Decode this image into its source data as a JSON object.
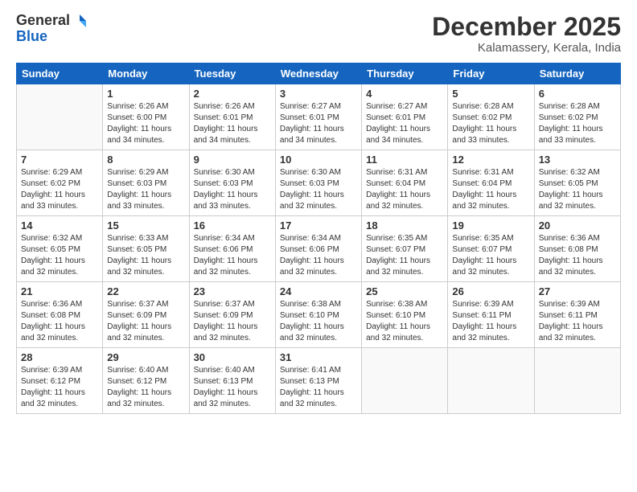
{
  "header": {
    "logo_general": "General",
    "logo_blue": "Blue",
    "month_title": "December 2025",
    "location": "Kalamassery, Kerala, India"
  },
  "weekdays": [
    "Sunday",
    "Monday",
    "Tuesday",
    "Wednesday",
    "Thursday",
    "Friday",
    "Saturday"
  ],
  "weeks": [
    [
      {
        "day": "",
        "info": ""
      },
      {
        "day": "1",
        "info": "Sunrise: 6:26 AM\nSunset: 6:00 PM\nDaylight: 11 hours\nand 34 minutes."
      },
      {
        "day": "2",
        "info": "Sunrise: 6:26 AM\nSunset: 6:01 PM\nDaylight: 11 hours\nand 34 minutes."
      },
      {
        "day": "3",
        "info": "Sunrise: 6:27 AM\nSunset: 6:01 PM\nDaylight: 11 hours\nand 34 minutes."
      },
      {
        "day": "4",
        "info": "Sunrise: 6:27 AM\nSunset: 6:01 PM\nDaylight: 11 hours\nand 34 minutes."
      },
      {
        "day": "5",
        "info": "Sunrise: 6:28 AM\nSunset: 6:02 PM\nDaylight: 11 hours\nand 33 minutes."
      },
      {
        "day": "6",
        "info": "Sunrise: 6:28 AM\nSunset: 6:02 PM\nDaylight: 11 hours\nand 33 minutes."
      }
    ],
    [
      {
        "day": "7",
        "info": "Sunrise: 6:29 AM\nSunset: 6:02 PM\nDaylight: 11 hours\nand 33 minutes."
      },
      {
        "day": "8",
        "info": "Sunrise: 6:29 AM\nSunset: 6:03 PM\nDaylight: 11 hours\nand 33 minutes."
      },
      {
        "day": "9",
        "info": "Sunrise: 6:30 AM\nSunset: 6:03 PM\nDaylight: 11 hours\nand 33 minutes."
      },
      {
        "day": "10",
        "info": "Sunrise: 6:30 AM\nSunset: 6:03 PM\nDaylight: 11 hours\nand 32 minutes."
      },
      {
        "day": "11",
        "info": "Sunrise: 6:31 AM\nSunset: 6:04 PM\nDaylight: 11 hours\nand 32 minutes."
      },
      {
        "day": "12",
        "info": "Sunrise: 6:31 AM\nSunset: 6:04 PM\nDaylight: 11 hours\nand 32 minutes."
      },
      {
        "day": "13",
        "info": "Sunrise: 6:32 AM\nSunset: 6:05 PM\nDaylight: 11 hours\nand 32 minutes."
      }
    ],
    [
      {
        "day": "14",
        "info": "Sunrise: 6:32 AM\nSunset: 6:05 PM\nDaylight: 11 hours\nand 32 minutes."
      },
      {
        "day": "15",
        "info": "Sunrise: 6:33 AM\nSunset: 6:05 PM\nDaylight: 11 hours\nand 32 minutes."
      },
      {
        "day": "16",
        "info": "Sunrise: 6:34 AM\nSunset: 6:06 PM\nDaylight: 11 hours\nand 32 minutes."
      },
      {
        "day": "17",
        "info": "Sunrise: 6:34 AM\nSunset: 6:06 PM\nDaylight: 11 hours\nand 32 minutes."
      },
      {
        "day": "18",
        "info": "Sunrise: 6:35 AM\nSunset: 6:07 PM\nDaylight: 11 hours\nand 32 minutes."
      },
      {
        "day": "19",
        "info": "Sunrise: 6:35 AM\nSunset: 6:07 PM\nDaylight: 11 hours\nand 32 minutes."
      },
      {
        "day": "20",
        "info": "Sunrise: 6:36 AM\nSunset: 6:08 PM\nDaylight: 11 hours\nand 32 minutes."
      }
    ],
    [
      {
        "day": "21",
        "info": "Sunrise: 6:36 AM\nSunset: 6:08 PM\nDaylight: 11 hours\nand 32 minutes."
      },
      {
        "day": "22",
        "info": "Sunrise: 6:37 AM\nSunset: 6:09 PM\nDaylight: 11 hours\nand 32 minutes."
      },
      {
        "day": "23",
        "info": "Sunrise: 6:37 AM\nSunset: 6:09 PM\nDaylight: 11 hours\nand 32 minutes."
      },
      {
        "day": "24",
        "info": "Sunrise: 6:38 AM\nSunset: 6:10 PM\nDaylight: 11 hours\nand 32 minutes."
      },
      {
        "day": "25",
        "info": "Sunrise: 6:38 AM\nSunset: 6:10 PM\nDaylight: 11 hours\nand 32 minutes."
      },
      {
        "day": "26",
        "info": "Sunrise: 6:39 AM\nSunset: 6:11 PM\nDaylight: 11 hours\nand 32 minutes."
      },
      {
        "day": "27",
        "info": "Sunrise: 6:39 AM\nSunset: 6:11 PM\nDaylight: 11 hours\nand 32 minutes."
      }
    ],
    [
      {
        "day": "28",
        "info": "Sunrise: 6:39 AM\nSunset: 6:12 PM\nDaylight: 11 hours\nand 32 minutes."
      },
      {
        "day": "29",
        "info": "Sunrise: 6:40 AM\nSunset: 6:12 PM\nDaylight: 11 hours\nand 32 minutes."
      },
      {
        "day": "30",
        "info": "Sunrise: 6:40 AM\nSunset: 6:13 PM\nDaylight: 11 hours\nand 32 minutes."
      },
      {
        "day": "31",
        "info": "Sunrise: 6:41 AM\nSunset: 6:13 PM\nDaylight: 11 hours\nand 32 minutes."
      },
      {
        "day": "",
        "info": ""
      },
      {
        "day": "",
        "info": ""
      },
      {
        "day": "",
        "info": ""
      }
    ]
  ]
}
